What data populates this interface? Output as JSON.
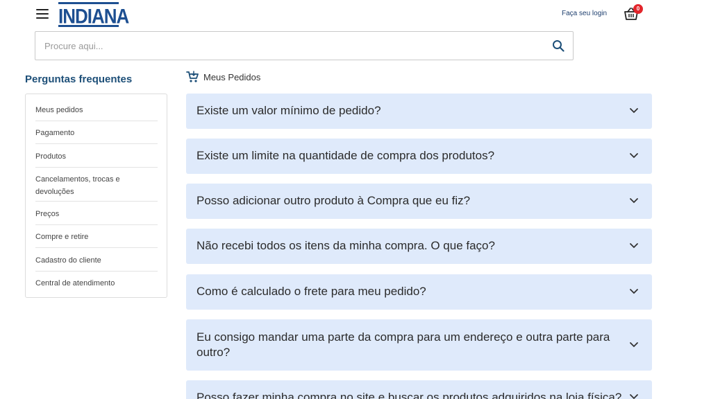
{
  "header": {
    "logo_text": "INDIANA",
    "login_label": "Faça seu login",
    "cart_count": "0",
    "icons": {
      "menu": "hamburger-menu-icon",
      "cart": "basket-icon"
    }
  },
  "search": {
    "placeholder": "Procure aqui...",
    "value": "",
    "icon": "search-icon"
  },
  "sidebar": {
    "title": "Perguntas frequentes",
    "items": [
      {
        "label": "Meus pedidos"
      },
      {
        "label": "Pagamento"
      },
      {
        "label": "Produtos"
      },
      {
        "label": "Cancelamentos, trocas e devoluções"
      },
      {
        "label": "Preços"
      },
      {
        "label": "Compre e retire"
      },
      {
        "label": "Cadastro do cliente"
      },
      {
        "label": "Central de atendimento"
      }
    ]
  },
  "main": {
    "breadcrumb": "Meus Pedidos",
    "breadcrumb_icon": "shopping-cart-icon",
    "faqs": [
      {
        "question": "Existe um valor mínimo de pedido?"
      },
      {
        "question": "Existe um limite na quantidade de compra dos produtos?"
      },
      {
        "question": "Posso adicionar outro produto à Compra que eu fiz?"
      },
      {
        "question": "Não recebi todos os itens da minha compra. O que faço?"
      },
      {
        "question": "Como é calculado o frete para meu pedido?"
      },
      {
        "question": "Eu consigo mandar uma parte da compra para um endereço e outra parte para outro?"
      },
      {
        "question": "Posso fazer minha compra no site e buscar os produtos adquiridos na loja física?"
      }
    ]
  },
  "colors": {
    "brand": "#1d4f91",
    "accent_blue": "#1d4f78",
    "faq_background": "#dfeafb",
    "badge": "#e3262c"
  }
}
